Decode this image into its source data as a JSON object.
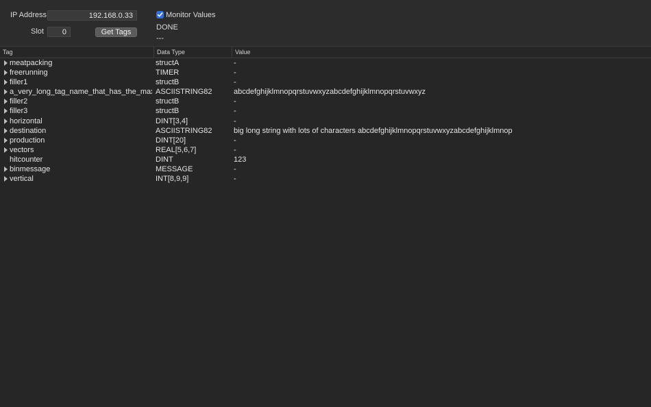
{
  "connection": {
    "ip_label": "IP Address",
    "ip_value": "192.168.0.33",
    "slot_label": "Slot",
    "slot_value": "0",
    "get_tags_label": "Get Tags",
    "monitor_label": "Monitor Values",
    "monitor_checked": true,
    "status": "DONE",
    "status_detail": "---"
  },
  "table": {
    "headers": {
      "tag": "Tag",
      "type": "Data Type",
      "value": "Value"
    },
    "rows": [
      {
        "tag": "meatpacking",
        "type": "structA",
        "value": "-",
        "expandable": true
      },
      {
        "tag": "freerunning",
        "type": "TIMER",
        "value": "-",
        "expandable": true
      },
      {
        "tag": "filler1",
        "type": "structB",
        "value": "-",
        "expandable": true
      },
      {
        "tag": "a_very_long_tag_name_that_has_the_max_nu",
        "type": "ASCIISTRING82",
        "value": "abcdefghijklmnopqrstuvwxyzabcdefghijklmnopqrstuvwxyz",
        "expandable": true
      },
      {
        "tag": "filler2",
        "type": "structB",
        "value": "-",
        "expandable": true
      },
      {
        "tag": "filler3",
        "type": "structB",
        "value": "-",
        "expandable": true
      },
      {
        "tag": "horizontal",
        "type": "DINT[3,4]",
        "value": "-",
        "expandable": true
      },
      {
        "tag": "destination",
        "type": "ASCIISTRING82",
        "value": "big long string with lots of characters abcdefghijklmnopqrstuvwxyzabcdefghijklmnop",
        "expandable": true
      },
      {
        "tag": "production",
        "type": "DINT[20]",
        "value": "-",
        "expandable": true
      },
      {
        "tag": "vectors",
        "type": "REAL[5,6,7]",
        "value": "-",
        "expandable": true
      },
      {
        "tag": "hitcounter",
        "type": "DINT",
        "value": "123",
        "expandable": false
      },
      {
        "tag": "binmessage",
        "type": "MESSAGE",
        "value": "-",
        "expandable": true
      },
      {
        "tag": "vertical",
        "type": "INT[8,9,9]",
        "value": "-",
        "expandable": true
      }
    ]
  },
  "icons": {
    "checkbox": "checkmark-icon",
    "disclosure": "disclosure-triangle-icon"
  },
  "colors": {
    "background": "#262626",
    "toolbar": "#2c2c2c",
    "accent": "#2f6dd8"
  }
}
